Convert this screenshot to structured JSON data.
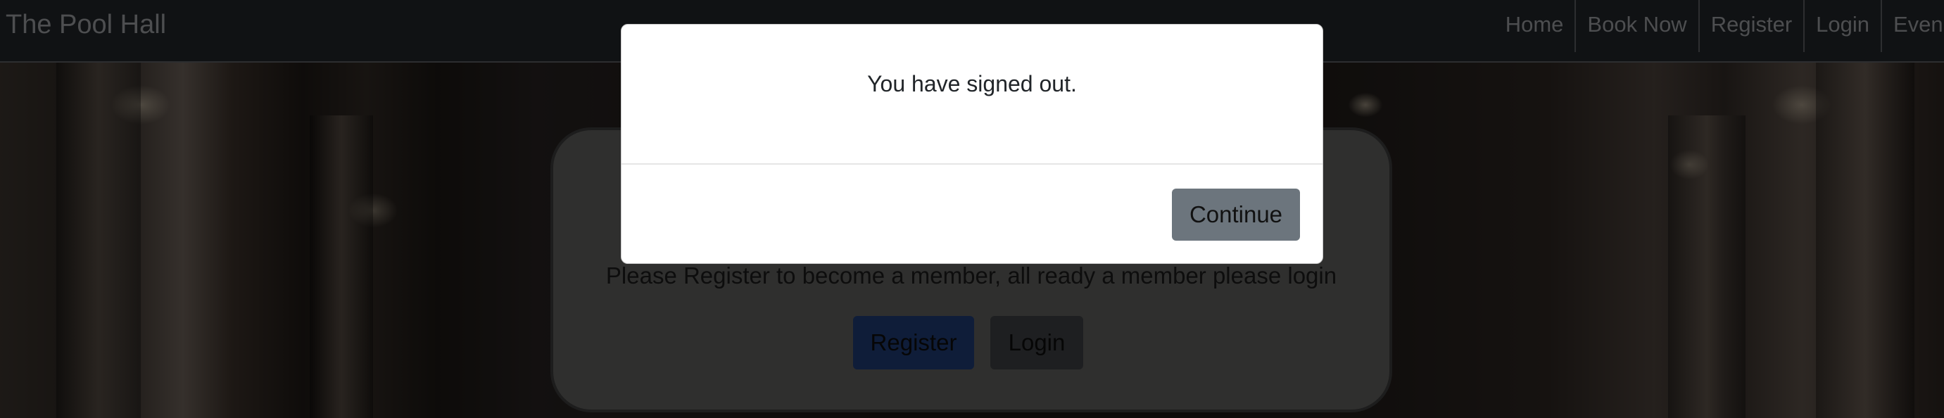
{
  "navbar": {
    "brand": "The Pool Hall",
    "links": [
      "Home",
      "Book Now",
      "Register",
      "Login",
      "Even"
    ]
  },
  "card": {
    "message": "Please Register to become a member, all ready a member please login",
    "register_label": "Register",
    "login_label": "Login"
  },
  "modal": {
    "message": "You have signed out.",
    "continue_label": "Continue"
  },
  "colors": {
    "navbar_bg": "#212529",
    "register_button": "#1f3a73",
    "continue_button": "#6c757d"
  }
}
